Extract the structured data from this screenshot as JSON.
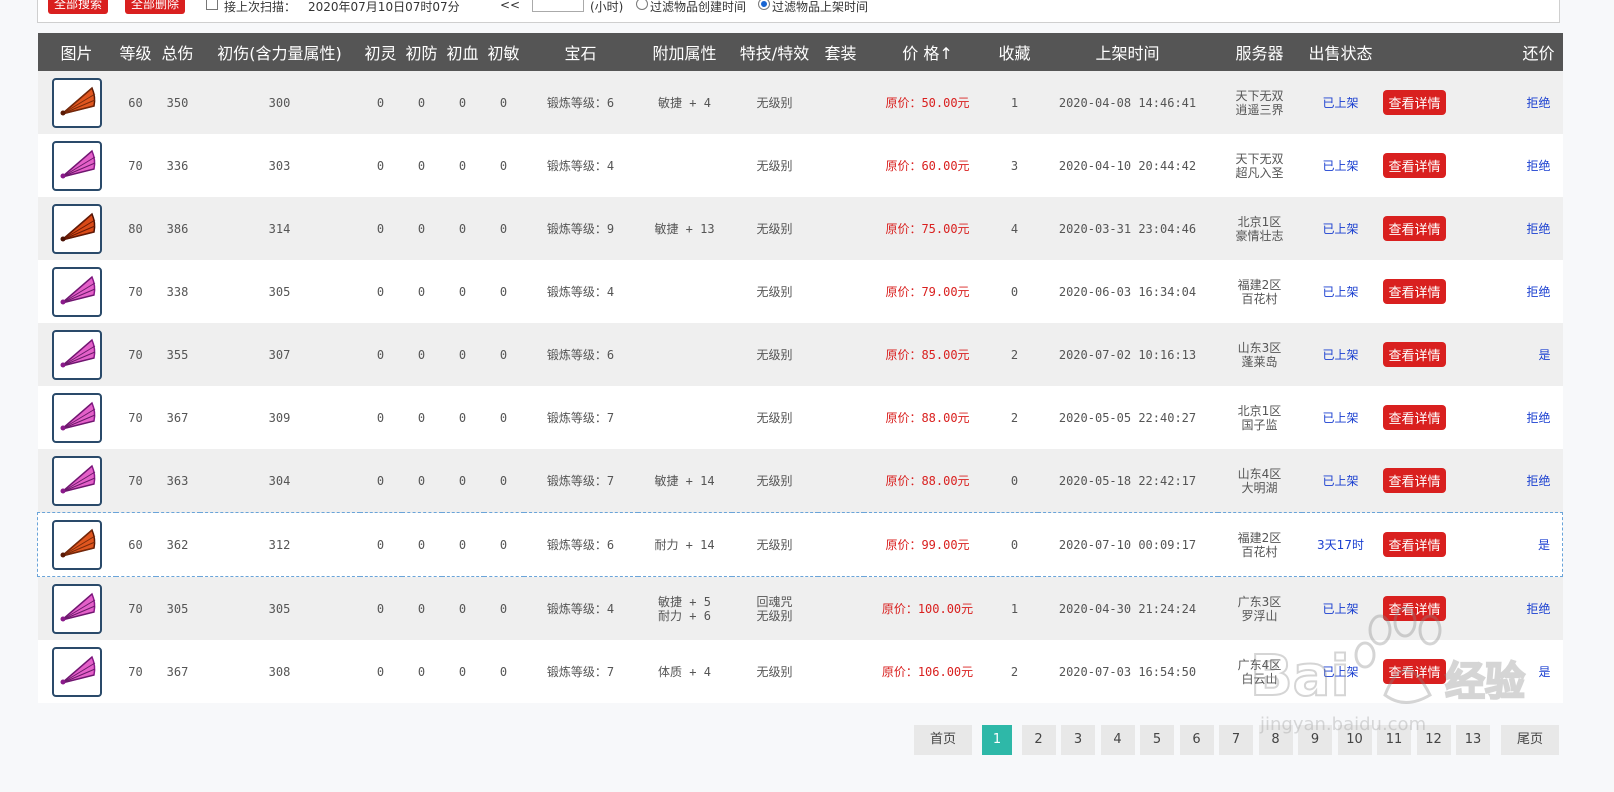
{
  "toolbar": {
    "scan_all": "全部搜索",
    "delete_all": "全部删除",
    "since_last_scan": "接上次扫描：",
    "scan_time": "2020年07月10日07时07分",
    "arrows": "<<",
    "hours_unit": "(小时)",
    "filter_created": "过滤物品创建时间",
    "filter_listed": "过滤物品上架时间"
  },
  "headers": [
    "图片",
    "等级",
    "总伤",
    "初伤(含力量属性)",
    "初灵",
    "初防",
    "初血",
    "初敏",
    "宝石",
    "附加属性",
    "特技/特效",
    "套装",
    "价 格↑",
    "收藏",
    "上架时间",
    "服务器",
    "出售状态",
    "",
    "还价"
  ],
  "detail_label": "查看详情",
  "rows": [
    {
      "icon": "fan-orange",
      "lv": "60",
      "dmg": "350",
      "init": "300",
      "ling": "0",
      "fang": "0",
      "xue": "0",
      "min": "0",
      "gem": "锻炼等级：6",
      "attr": "敏捷 + 4",
      "skill": "无级别",
      "price": "原价：50.00元",
      "fav": "1",
      "time": "2020-04-08 14:46:41",
      "server1": "天下无双",
      "server2": "逍遥三界",
      "status": "已上架",
      "counter": "拒绝"
    },
    {
      "icon": "fan-pink",
      "lv": "70",
      "dmg": "336",
      "init": "303",
      "ling": "0",
      "fang": "0",
      "xue": "0",
      "min": "0",
      "gem": "锻炼等级：4",
      "attr": "",
      "skill": "无级别",
      "price": "原价：60.00元",
      "fav": "3",
      "time": "2020-04-10 20:44:42",
      "server1": "天下无双",
      "server2": "超凡入圣",
      "status": "已上架",
      "counter": "拒绝"
    },
    {
      "icon": "fan-red",
      "lv": "80",
      "dmg": "386",
      "init": "314",
      "ling": "0",
      "fang": "0",
      "xue": "0",
      "min": "0",
      "gem": "锻炼等级：9",
      "attr": "敏捷 + 13",
      "skill": "无级别",
      "price": "原价：75.00元",
      "fav": "4",
      "time": "2020-03-31 23:04:46",
      "server1": "北京1区",
      "server2": "豪情壮志",
      "status": "已上架",
      "counter": "拒绝"
    },
    {
      "icon": "fan-pink",
      "lv": "70",
      "dmg": "338",
      "init": "305",
      "ling": "0",
      "fang": "0",
      "xue": "0",
      "min": "0",
      "gem": "锻炼等级：4",
      "attr": "",
      "skill": "无级别",
      "price": "原价：79.00元",
      "fav": "0",
      "time": "2020-06-03 16:34:04",
      "server1": "福建2区",
      "server2": "百花村",
      "status": "已上架",
      "counter": "拒绝"
    },
    {
      "icon": "fan-pink",
      "lv": "70",
      "dmg": "355",
      "init": "307",
      "ling": "0",
      "fang": "0",
      "xue": "0",
      "min": "0",
      "gem": "锻炼等级：6",
      "attr": "",
      "skill": "无级别",
      "price": "原价：85.00元",
      "fav": "2",
      "time": "2020-07-02 10:16:13",
      "server1": "山东3区",
      "server2": "蓬莱岛",
      "status": "已上架",
      "counter": "是"
    },
    {
      "icon": "fan-pink",
      "lv": "70",
      "dmg": "367",
      "init": "309",
      "ling": "0",
      "fang": "0",
      "xue": "0",
      "min": "0",
      "gem": "锻炼等级：7",
      "attr": "",
      "skill": "无级别",
      "price": "原价：88.00元",
      "fav": "2",
      "time": "2020-05-05 22:40:27",
      "server1": "北京1区",
      "server2": "国子监",
      "status": "已上架",
      "counter": "拒绝"
    },
    {
      "icon": "fan-pink",
      "lv": "70",
      "dmg": "363",
      "init": "304",
      "ling": "0",
      "fang": "0",
      "xue": "0",
      "min": "0",
      "gem": "锻炼等级：7",
      "attr": "敏捷 + 14",
      "skill": "无级别",
      "price": "原价：88.00元",
      "fav": "0",
      "time": "2020-05-18 22:42:17",
      "server1": "山东4区",
      "server2": "大明湖",
      "status": "已上架",
      "counter": "拒绝"
    },
    {
      "icon": "fan-orange",
      "lv": "60",
      "dmg": "362",
      "init": "312",
      "ling": "0",
      "fang": "0",
      "xue": "0",
      "min": "0",
      "gem": "锻炼等级：6",
      "attr": "耐力 + 14",
      "skill": "无级别",
      "price": "原价：99.00元",
      "fav": "0",
      "time": "2020-07-10 00:09:17",
      "server1": "福建2区",
      "server2": "百花村",
      "status": "3天17时",
      "counter": "是"
    },
    {
      "icon": "fan-pink",
      "lv": "70",
      "dmg": "305",
      "init": "305",
      "ling": "0",
      "fang": "0",
      "xue": "0",
      "min": "0",
      "gem": "锻炼等级：4",
      "attr": "敏捷 + 5",
      "attr2": "耐力 + 6",
      "skill": "回魂咒",
      "skill2": "无级别",
      "price": "原价：100.00元",
      "fav": "1",
      "time": "2020-04-30 21:24:24",
      "server1": "广东3区",
      "server2": "罗浮山",
      "status": "已上架",
      "counter": "拒绝"
    },
    {
      "icon": "fan-pink",
      "lv": "70",
      "dmg": "367",
      "init": "308",
      "ling": "0",
      "fang": "0",
      "xue": "0",
      "min": "0",
      "gem": "锻炼等级：7",
      "attr": "体质 + 4",
      "skill": "无级别",
      "price": "原价：106.00元",
      "fav": "2",
      "time": "2020-07-03 16:54:50",
      "server1": "广东4区",
      "server2": "白云山",
      "status": "已上架",
      "counter": "是"
    }
  ],
  "pagination": {
    "first": "首页",
    "pages": [
      "1",
      "2",
      "3",
      "4",
      "5",
      "6",
      "7",
      "8",
      "9",
      "10",
      "11",
      "12",
      "13"
    ],
    "current": "1",
    "last": "尾页"
  },
  "watermark": {
    "brand": "Baidu",
    "cn": "经验",
    "url": "jingyan.baidu.com"
  },
  "colors": {
    "accent_red": "#d9201f",
    "header_bg": "#555555",
    "status_blue": "#1a3fd0",
    "page_active": "#2eb8a8"
  }
}
